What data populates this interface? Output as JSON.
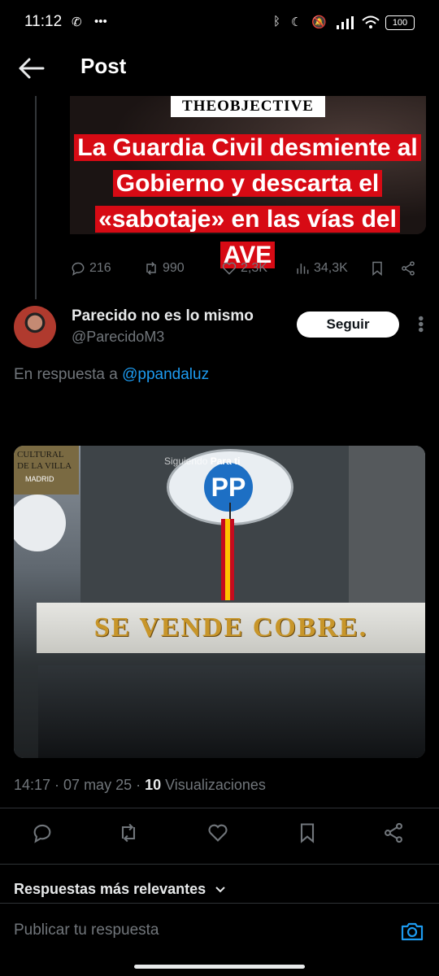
{
  "status_bar": {
    "time": "11:12",
    "battery": "100"
  },
  "header": {
    "title": "Post"
  },
  "quoted_post": {
    "brand": "THEOBJECTIVE",
    "headline_lines": [
      "La Guardia Civil desmiente al",
      "Gobierno y descarta el",
      "«sabotaje» en las vías del AVE"
    ],
    "metrics": {
      "replies": "216",
      "reposts": "990",
      "likes": "2,3K",
      "views": "34,3K"
    }
  },
  "reply_post": {
    "author_name": "Parecido no es lo mismo",
    "author_handle": "@ParecidoM3",
    "follow_label": "Seguir",
    "reply_prefix": "En respuesta a",
    "reply_handle": "@ppandaluz",
    "image": {
      "logo_text": "PP",
      "overlay_tab_1": "Siguiendo",
      "overlay_tab_2": "Para ti",
      "sign_text": "SE VENDE COBRE.",
      "banner_text": "CULTURAL DE LA VILLA",
      "banner_sub": "MADRID"
    },
    "timestamp": "14:17 · 07 may 25 · ",
    "view_count": "10",
    "views_label": " Visualizaciones"
  },
  "replies_section": {
    "sort_label": "Respuestas más relevantes",
    "input_placeholder": "Publicar tu respuesta"
  },
  "colors": {
    "accent": "#1d9bf0",
    "headline_bg": "#d70a14",
    "sign_gold": "#c8962a"
  }
}
